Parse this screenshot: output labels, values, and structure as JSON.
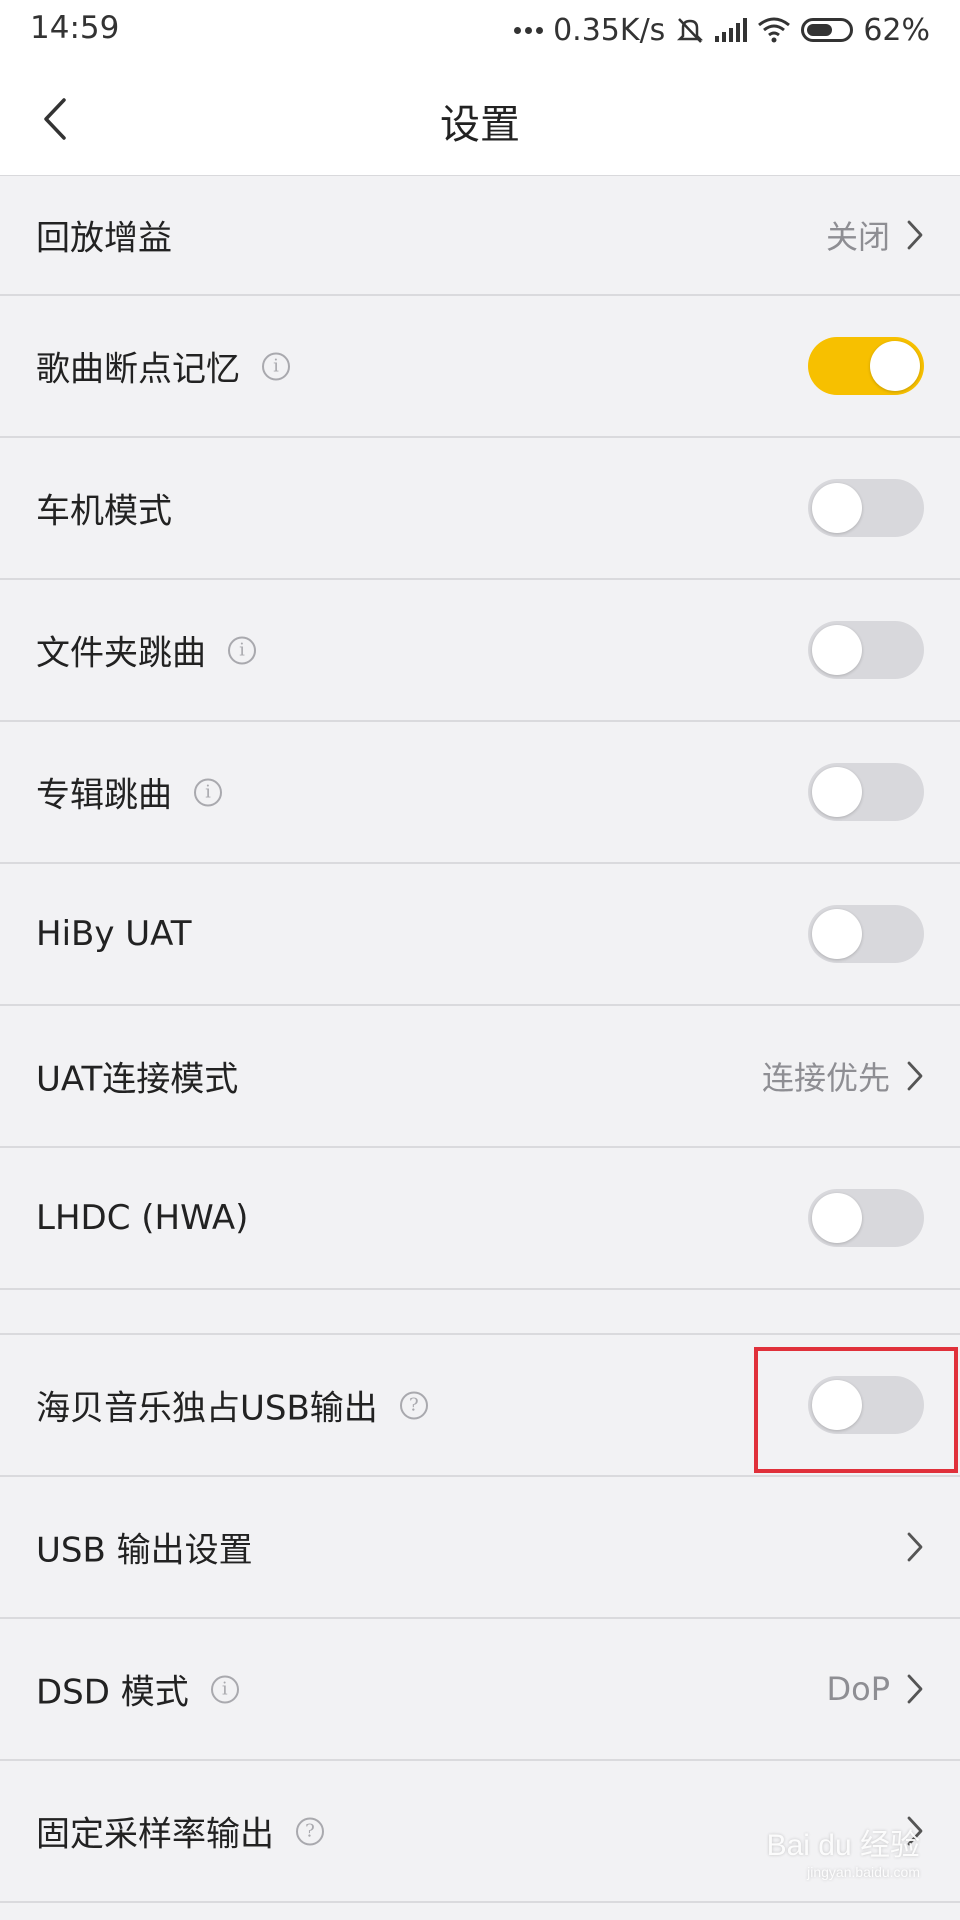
{
  "status_bar": {
    "time": "14:59",
    "network_speed": "0.35K/s",
    "battery_percent": "62%",
    "battery_level": 0.62,
    "icons": [
      "more-dots-icon",
      "mute-bell-icon",
      "signal-icon",
      "wifi-icon",
      "battery-icon"
    ]
  },
  "header": {
    "title": "设置",
    "back_icon": "chevron-left-icon"
  },
  "rows": [
    {
      "label": "回放增益",
      "type": "value",
      "value": "关闭"
    },
    {
      "label": "歌曲断点记忆",
      "type": "toggle",
      "info": "i",
      "on": true
    },
    {
      "label": "车机模式",
      "type": "toggle",
      "on": false
    },
    {
      "label": "文件夹跳曲",
      "type": "toggle",
      "info": "i",
      "on": false
    },
    {
      "label": "专辑跳曲",
      "type": "toggle",
      "info": "i",
      "on": false
    },
    {
      "label": "HiBy UAT",
      "type": "toggle",
      "on": false
    },
    {
      "label": "UAT连接模式",
      "type": "value",
      "value": "连接优先"
    },
    {
      "label": "LHDC (HWA)",
      "type": "toggle",
      "on": false
    },
    {
      "label": "海贝音乐独占USB输出",
      "type": "toggle",
      "info": "?",
      "on": false,
      "highlighted": true
    },
    {
      "label": "USB 输出设置",
      "type": "value",
      "value": ""
    },
    {
      "label": "DSD 模式",
      "type": "value",
      "info": "i",
      "value": "DoP"
    },
    {
      "label": "固定采样率输出",
      "type": "value",
      "info": "?",
      "value": ""
    }
  ],
  "colors": {
    "accent_toggle_on": "#f7c000",
    "toggle_off": "#d8d8dc",
    "highlight_box": "#e0303a",
    "background": "#f2f2f4"
  },
  "watermark": {
    "text": "Bai du 经验",
    "subtext": "jingyan.baidu.com"
  }
}
